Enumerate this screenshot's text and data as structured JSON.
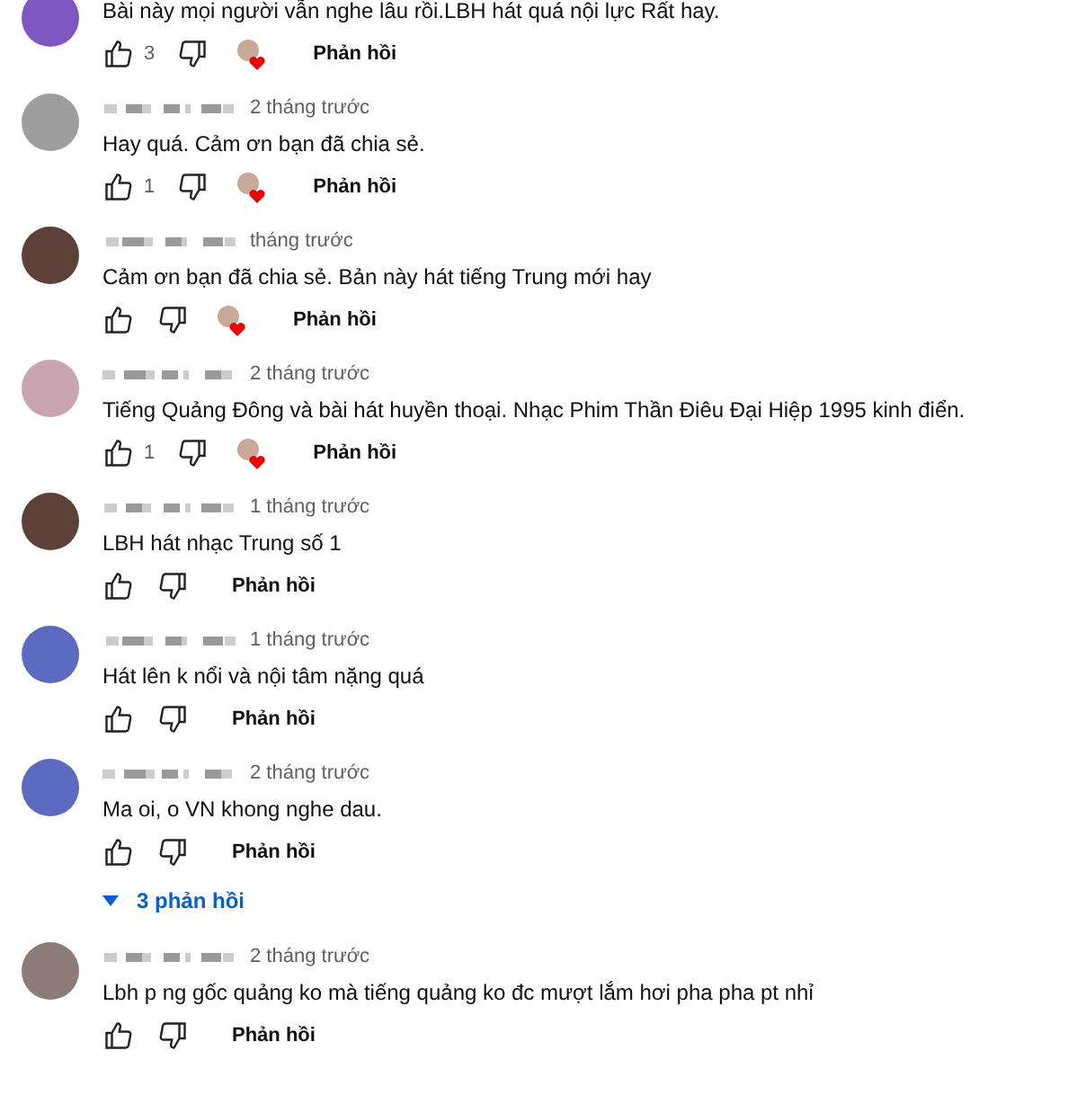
{
  "comments": [
    {
      "color": "#7e57c2",
      "text": "Bài này mọi người vẫn nghe lâu rồi.LBH hát quá nội lực Rất hay.",
      "likes": "3",
      "hearted": true,
      "reply": "Phản hồi"
    },
    {
      "color": "#9e9e9e",
      "time": "2 tháng trước",
      "text": "Hay quá. Cảm ơn bạn đã chia sẻ.",
      "likes": "1",
      "hearted": true,
      "reply": "Phản hồi"
    },
    {
      "color": "#5d4037",
      "time": "tháng trước",
      "text": "Cảm ơn bạn đã chia sẻ. Bản này hát tiếng Trung mới hay",
      "hearted": true,
      "reply": "Phản hồi"
    },
    {
      "color": "#c9a3b0",
      "time": "2 tháng trước",
      "text": "Tiếng Quảng Đông và bài hát huyền thoại. Nhạc Phim Thần Điêu Đại Hiệp 1995 kinh điển.",
      "likes": "1",
      "hearted": true,
      "reply": "Phản hồi"
    },
    {
      "color": "#5d4037",
      "time": "1 tháng trước",
      "text": "LBH hát nhạc Trung số 1",
      "hearted": false,
      "reply": "Phản hồi"
    },
    {
      "color": "#5c6bc0",
      "time": "1 tháng trước",
      "text": "Hát lên k nổi và nội tâm nặng quá",
      "hearted": false,
      "reply": "Phản hồi"
    },
    {
      "color": "#5c6bc0",
      "time": "2 tháng trước",
      "text": "Ma oi, o VN khong nghe dau.",
      "hearted": false,
      "reply": "Phản hồi",
      "replies": "3 phản hồi"
    },
    {
      "color": "#8d7b78",
      "time": "2 tháng trước",
      "text": "Lbh p ng gốc quảng ko mà tiếng quảng ko đc mượt lắm hơi pha pha pt nhỉ",
      "hearted": false,
      "reply": "Phản hồi"
    }
  ]
}
